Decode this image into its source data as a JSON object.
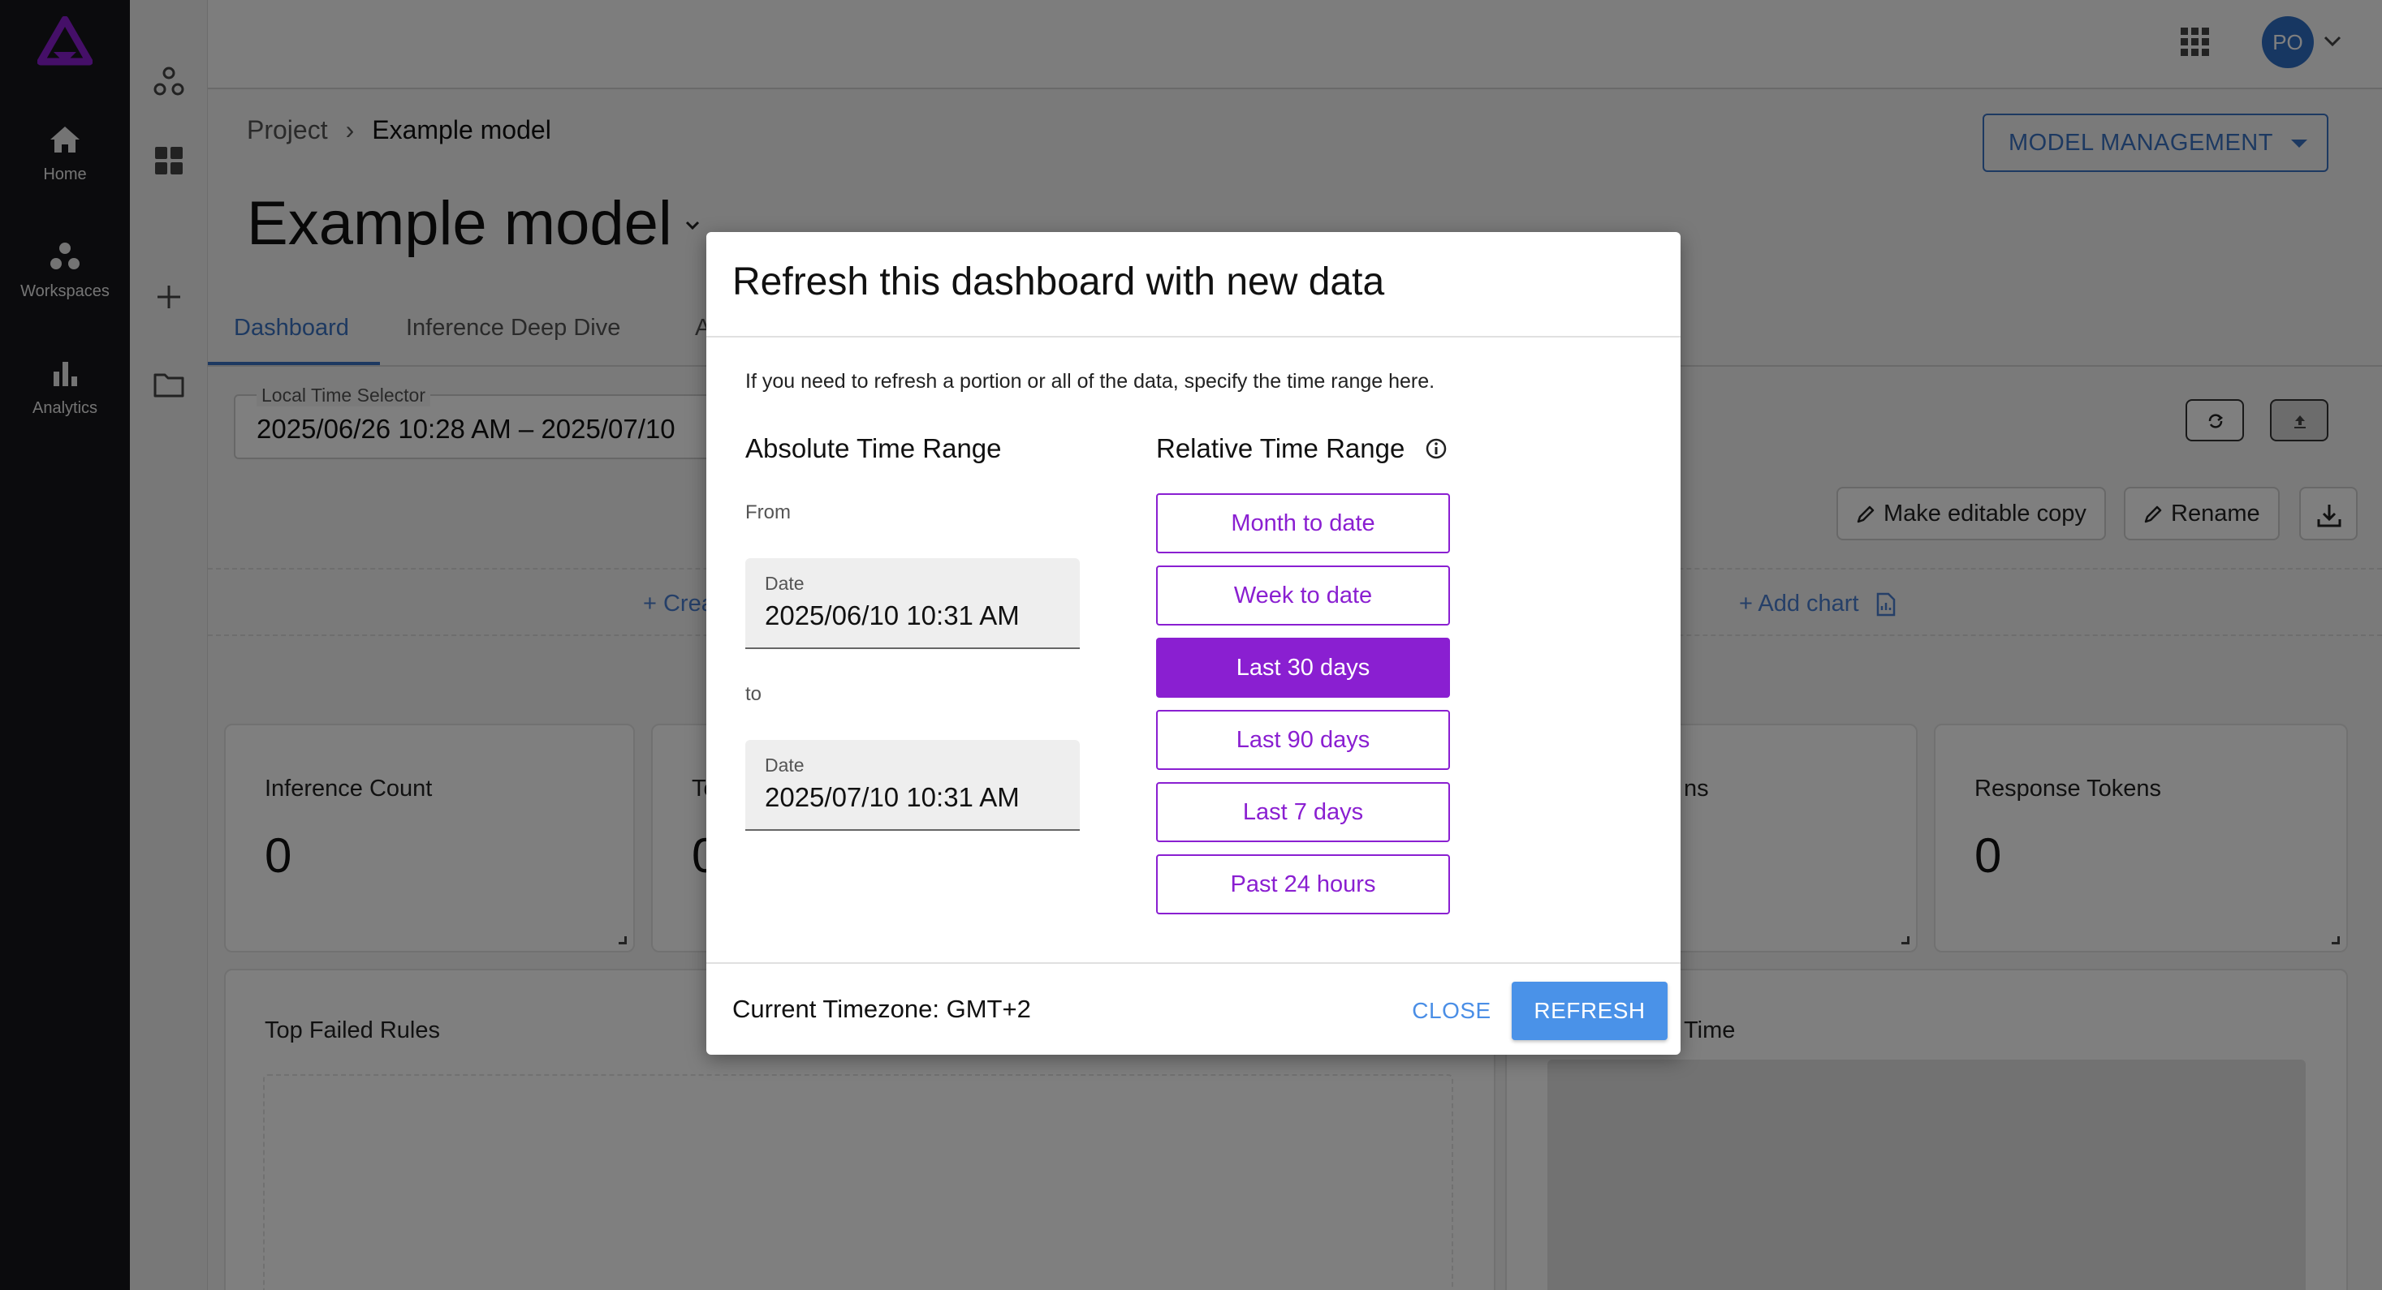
{
  "nav": {
    "items": [
      {
        "label": "Home",
        "icon": "home-icon"
      },
      {
        "label": "Workspaces",
        "icon": "workspaces-icon"
      },
      {
        "label": "Analytics",
        "icon": "analytics-icon"
      }
    ],
    "logo_color": "#8a1fd1"
  },
  "topbar": {
    "avatar_initials": "PO",
    "avatar_color": "#2f6fc4"
  },
  "breadcrumb": {
    "parent": "Project",
    "current": "Example model"
  },
  "page": {
    "title": "Example model",
    "model_management_label": "MODEL MANAGEMENT"
  },
  "tabs": [
    {
      "label": "Dashboard",
      "active": true
    },
    {
      "label": "Inference Deep Dive",
      "active": false
    },
    {
      "label": "A",
      "active": false
    }
  ],
  "time_selector": {
    "label": "Local Time Selector",
    "value": "2025/06/26 10:28 AM – 2025/07/10"
  },
  "toolbar": {
    "make_editable_copy": "Make editable copy",
    "rename": "Rename"
  },
  "charts": {
    "create_label": "+ Crea",
    "add_chart_label": "+ Add chart"
  },
  "cards": [
    {
      "title": "Inference Count",
      "value": "0"
    },
    {
      "title": "To",
      "value": "0"
    },
    {
      "title": "ns",
      "value": ""
    },
    {
      "title": "Response Tokens",
      "value": "0"
    }
  ],
  "panels": [
    {
      "title": "Top Failed Rules"
    },
    {
      "title": "Time"
    }
  ],
  "modal": {
    "title": "Refresh this dashboard with new data",
    "description": "If you need to refresh a portion or all of the data, specify the time range here.",
    "absolute_title": "Absolute Time Range",
    "relative_title": "Relative Time Range",
    "from_label": "From",
    "to_label": "to",
    "date_label": "Date",
    "from_value": "2025/06/10 10:31 AM",
    "to_value": "2025/07/10 10:31 AM",
    "relative_options": [
      {
        "label": "Month to date",
        "selected": false
      },
      {
        "label": "Week to date",
        "selected": false
      },
      {
        "label": "Last 30 days",
        "selected": true
      },
      {
        "label": "Last 90 days",
        "selected": false
      },
      {
        "label": "Last 7 days",
        "selected": false
      },
      {
        "label": "Past 24 hours",
        "selected": false
      }
    ],
    "timezone": "Current Timezone: GMT+2",
    "close_label": "CLOSE",
    "refresh_label": "REFRESH",
    "accent_color": "#8a1fd1",
    "primary_color": "#4a92e8"
  }
}
